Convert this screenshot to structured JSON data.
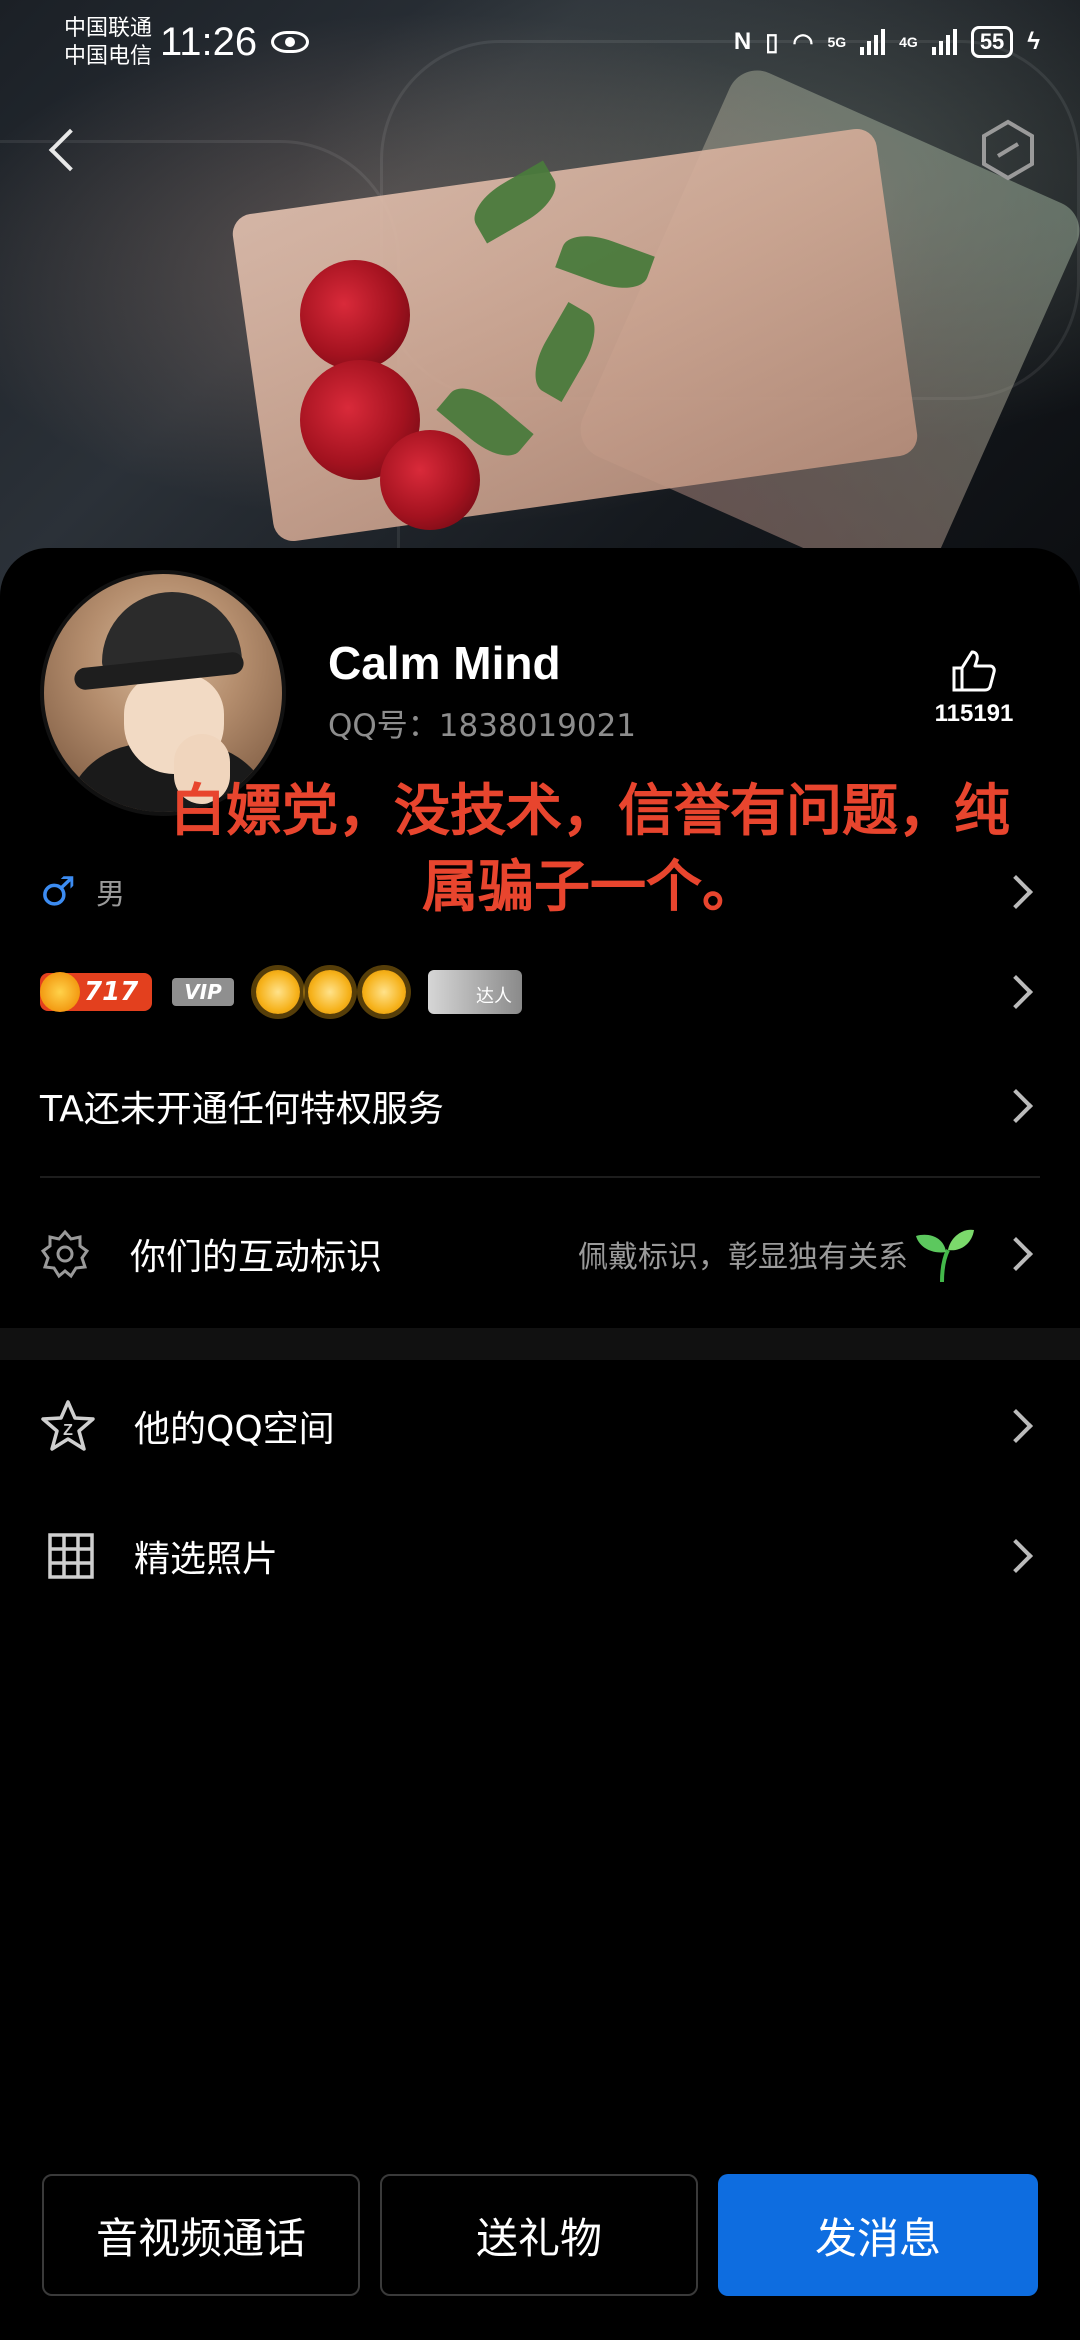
{
  "status_bar": {
    "carrier1": "中国联通",
    "carrier2": "中国电信",
    "time": "11:26",
    "net1": "5G",
    "net2": "4G",
    "battery": "55"
  },
  "profile": {
    "name": "Calm Mind",
    "qq_id": "QQ号：1838019021",
    "likes": "115191",
    "gender": "男",
    "level": "717",
    "vip": "VIP",
    "daren": "达人"
  },
  "overlay_text": {
    "line1": "白嫖党，没技术，信誉有问题，纯",
    "line2": "属骗子一个。"
  },
  "privilege": {
    "text": "TA还未开通任何特权服务"
  },
  "interaction_mark": {
    "title": "你们的互动标识",
    "subtitle": "佩戴标识，彰显独有关系"
  },
  "list": {
    "qzone": "他的QQ空间",
    "photos": "精选照片"
  },
  "buttons": {
    "call": "音视频通话",
    "gift": "送礼物",
    "message": "发消息"
  },
  "colors": {
    "primary": "#0e6de0",
    "overlay_red": "#e8452e",
    "gender_blue": "#3c8cf2"
  }
}
